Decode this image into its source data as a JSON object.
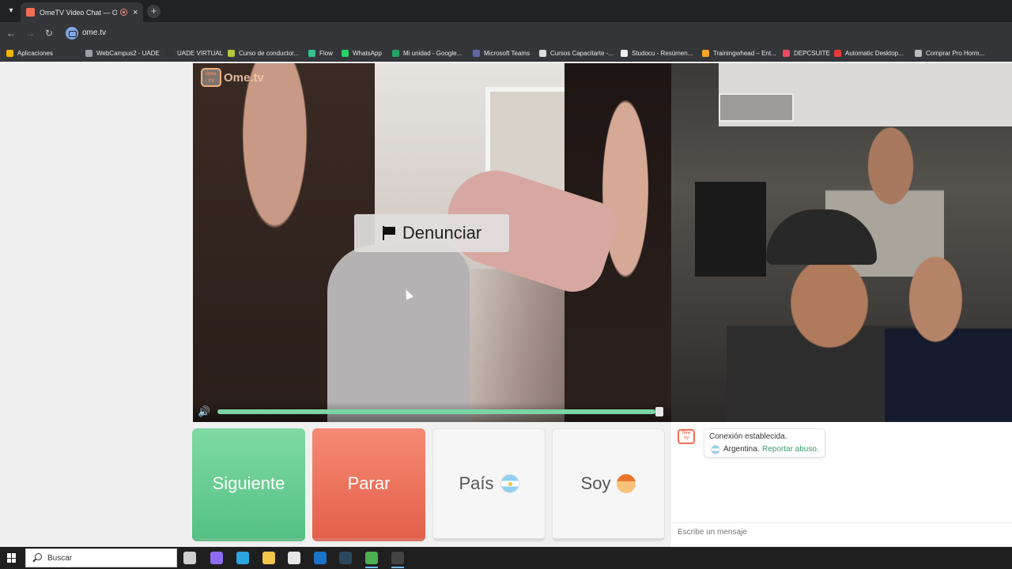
{
  "browser": {
    "tab_title": "OmeTV Video Chat — Ome",
    "tab_close": "×",
    "new_tab": "+",
    "url": "ome.tv"
  },
  "bookmarks": [
    {
      "label": "Aplicaciones",
      "color": "#f4b400"
    },
    {
      "label": "WebCampus2 - UADE",
      "color": "#9aa0a6"
    },
    {
      "label": "UADE VIRTUAL",
      "color": "#333333"
    },
    {
      "label": "Curso de conductor...",
      "color": "#b7c83c"
    },
    {
      "label": "Flow",
      "color": "#34c38f"
    },
    {
      "label": "WhatsApp",
      "color": "#25d366"
    },
    {
      "label": "Mi unidad - Google...",
      "color": "#1fa463"
    },
    {
      "label": "Microsoft Teams",
      "color": "#6264a7"
    },
    {
      "label": "Cursos Capacitarte -...",
      "color": "#dddddd"
    },
    {
      "label": "Studocu - Resúmen...",
      "color": "#eeeeee"
    },
    {
      "label": "Trainingwhead – Ent...",
      "color": "#f5a623"
    },
    {
      "label": "DEPCSUITE",
      "color": "#e94b5f"
    },
    {
      "label": "Automatic Desktop...",
      "color": "#e53935"
    },
    {
      "label": "Comprar Pro Horm...",
      "color": "#bbbbbb"
    }
  ],
  "video": {
    "logo_top": "Ome",
    "logo_bottom": "TV",
    "logo_text": "Ome.tv",
    "report_label": "Denunciar",
    "volume_icon": "speaker-icon",
    "volume_level": 0.99
  },
  "controls": {
    "next_label": "Siguiente",
    "stop_label": "Parar",
    "country_label": "País",
    "gender_label": "Soy"
  },
  "chat": {
    "logo_top": "Ome",
    "logo_bottom": "TV",
    "status": "Conexión establecida.",
    "country": "Argentina.",
    "report_link": "Reportar abuso.",
    "input_placeholder": "Escribe un mensaje"
  },
  "taskbar": {
    "search_label": "Buscar",
    "icons": [
      {
        "name": "task-view-icon",
        "color": "#d0d0d0"
      },
      {
        "name": "copilot-icon",
        "color": "#8e6cf0"
      },
      {
        "name": "edge-icon",
        "color": "#2aa7e0"
      },
      {
        "name": "file-explorer-icon",
        "color": "#f3c64a"
      },
      {
        "name": "store-icon",
        "color": "#e6e6e6"
      },
      {
        "name": "outlook-icon",
        "color": "#1a73c7"
      },
      {
        "name": "steam-icon",
        "color": "#2a475e"
      },
      {
        "name": "chrome-icon",
        "color": "#4caf50"
      },
      {
        "name": "obs-icon",
        "color": "#444444"
      }
    ]
  }
}
